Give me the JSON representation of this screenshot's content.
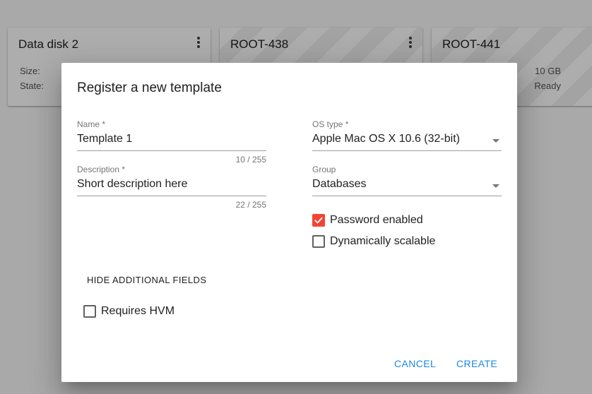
{
  "cards": [
    {
      "title": "Data disk 2",
      "rows": [
        {
          "label": "Size:",
          "value": ""
        },
        {
          "label": "State:",
          "value": ""
        }
      ],
      "has_menu": true
    },
    {
      "title": "ROOT-438",
      "rows": [],
      "has_menu": true
    },
    {
      "title": "ROOT-441",
      "rows": [
        {
          "label": "",
          "value": "10 GB"
        },
        {
          "label": "",
          "value": "Ready"
        }
      ],
      "has_menu": false
    }
  ],
  "dialog": {
    "title": "Register a new template",
    "name": {
      "label": "Name *",
      "value": "Template 1",
      "counter": "10 / 255"
    },
    "description": {
      "label": "Description *",
      "value": "Short description here",
      "counter": "22 / 255"
    },
    "os_type": {
      "label": "OS type *",
      "value": "Apple Mac OS X 10.6 (32-bit)"
    },
    "group": {
      "label": "Group",
      "value": "Databases"
    },
    "password_enabled": {
      "label": "Password enabled",
      "checked": true
    },
    "dynamically_scalable": {
      "label": "Dynamically scalable",
      "checked": false
    },
    "hide_fields_label": "HIDE ADDITIONAL FIELDS",
    "requires_hvm": {
      "label": "Requires HVM",
      "checked": false
    },
    "cancel_label": "CANCEL",
    "create_label": "CREATE"
  },
  "colors": {
    "accent": "#f44336",
    "primary_button": "#1e88e5"
  },
  "icons": {
    "card_menu": "more-vert-icon",
    "select": "dropdown-arrow-icon",
    "check": "check-icon"
  }
}
